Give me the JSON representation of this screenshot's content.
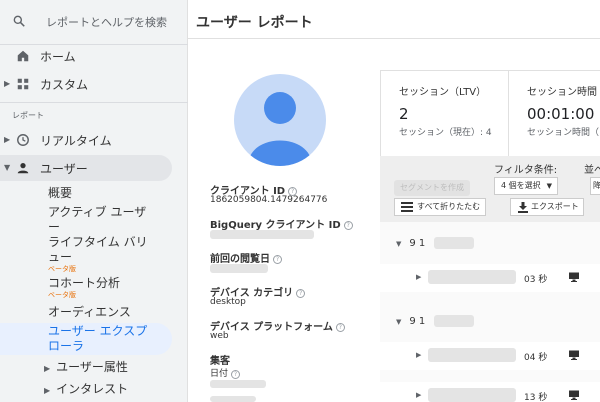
{
  "search": {
    "placeholder": "レポートとヘルプを検索",
    "icon": "search-icon"
  },
  "sidebar": {
    "home": {
      "label": "ホーム",
      "icon": "home-icon"
    },
    "custom": {
      "label": "カスタム",
      "icon": "grid-icon"
    },
    "section_label": "レポート",
    "realtime": {
      "label": "リアルタイム",
      "icon": "clock-icon"
    },
    "user": {
      "label": "ユーザー",
      "icon": "person-icon"
    },
    "sub_items": [
      {
        "label": "概要"
      },
      {
        "label_line1": "アクティブ ユーザ",
        "label_line2": "ー"
      },
      {
        "label_line1": "ライフタイム バリ",
        "label_line2": "ュー",
        "badge": "ベータ版"
      },
      {
        "label": "コホート分析",
        "badge": "ベータ版"
      },
      {
        "label": "オーディエンス"
      },
      {
        "label_line1": "ユーザー エクスプ",
        "label_line2": "ローラ",
        "selected": true
      }
    ],
    "collapsible": [
      {
        "label": "ユーザー属性"
      },
      {
        "label": "インタレスト"
      }
    ],
    "active_bg": "#e3e5e8",
    "selected_color": "#1a73e8"
  },
  "header": {
    "title": "ユーザー レポート"
  },
  "profile": {
    "avatar_icon": "user-avatar-icon",
    "client_id_label": "クライアント ID",
    "client_id": "1862059804.1479264776",
    "bq_label": "BigQuery クライアント ID",
    "last_visit_label": "前回の閲覧日",
    "device_cat_label": "デバイス カテゴリ",
    "device_cat": "desktop",
    "device_platform_label": "デバイス プラットフォーム",
    "device_platform": "web",
    "acquisition_label": "集客",
    "date_label": "日付",
    "help_mark": "?"
  },
  "stats": [
    {
      "title": "セッション（LTV）",
      "value": "2",
      "sub": "セッション（現在）: 4"
    },
    {
      "title": "セッション時間（",
      "value": "00:01:00",
      "sub": "セッション時間（"
    }
  ],
  "toolbar": {
    "segment_btn": "セグメントを作成",
    "filter_label": "フィルタ条件:",
    "filter_value": "4 個を選択",
    "collapse_btn": "すべて折りたたむ",
    "export_btn": "エクスポート",
    "sort_label": "並べ",
    "sort_value": "降"
  },
  "timeline": {
    "dates": [
      "9 1",
      "9 1"
    ],
    "events": [
      {
        "duration": "03 秒",
        "icon": "desktop-icon"
      },
      {
        "duration": "04 秒",
        "icon": "desktop-icon"
      },
      {
        "duration": "13 秒",
        "icon": "desktop-icon"
      }
    ]
  },
  "colors": {
    "accent": "#1a73e8",
    "avatar_bg": "#c7daf7",
    "avatar_fg": "#4b8bea",
    "beta": "#e8710a"
  }
}
